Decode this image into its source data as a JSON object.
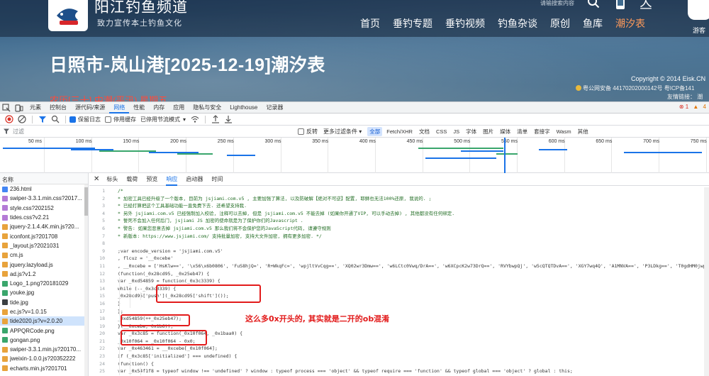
{
  "site": {
    "title": "阳江钓鱼频道",
    "slogan": "致力宣传本土钓鱼文化",
    "search_placeholder": "请输搜索内容",
    "ren_glyph": "亼",
    "guest": "游客",
    "nav": [
      "首页",
      "垂钓专题",
      "垂钓视频",
      "钓鱼杂谈",
      "原创",
      "鱼库",
      "潮汐表"
    ],
    "page_title": "日照市-岚山港[2025-12-19]潮汐表",
    "copyright": "Copyright © 2014 Eisk.CN",
    "icp": "粤公网安备 44170202000142号   粤ICP备141",
    "friend_links": "友情链接：   潮",
    "lunar": "农历[三十] 中潮(平汛) 星期五"
  },
  "devtools": {
    "tabs": [
      "元素",
      "控制台",
      "源代码/来源",
      "网络",
      "性能",
      "内存",
      "应用",
      "隐私与安全",
      "Lighthouse",
      "记录器"
    ],
    "active_tab": "网络",
    "errors": "1",
    "warnings": "4",
    "toolbar": {
      "preserve_log": "保留日志",
      "disable_cache": "停用缓存",
      "throttle": "已停用节流模式"
    },
    "filter": {
      "placeholder": "过滤",
      "invert": "反转",
      "more_filters": "更多过滤条件 ▾",
      "chips": [
        "全部",
        "Fetch/XHR",
        "文档",
        "CSS",
        "JS",
        "字体",
        "图片",
        "媒体",
        "清单",
        "套接字",
        "Wasm",
        "其他"
      ],
      "active_chip": "全部"
    },
    "timeline": {
      "ticks": [
        "50 ms",
        "100 ms",
        "150 ms",
        "200 ms",
        "250 ms",
        "300 ms",
        "350 ms",
        "400 ms",
        "450 ms",
        "500 ms",
        "550 ms",
        "600 ms",
        "650 ms",
        "700 ms",
        "750 ms"
      ]
    },
    "request_list": {
      "header": "名称",
      "items": [
        {
          "name": "236.html",
          "type": "doc"
        },
        {
          "name": "swiper-3.3.1.min.css?2017...",
          "type": "css"
        },
        {
          "name": "style.css?202152",
          "type": "css"
        },
        {
          "name": "tides.css?v2.21",
          "type": "css"
        },
        {
          "name": "jquery-2.1.4.4K.min.js?20...",
          "type": "js"
        },
        {
          "name": "iconfont.js?201708",
          "type": "js"
        },
        {
          "name": "_layout.js?2021031",
          "type": "js"
        },
        {
          "name": "cm.js",
          "type": "js"
        },
        {
          "name": "jquery.lazyload.js",
          "type": "js"
        },
        {
          "name": "ad.js?v1.2",
          "type": "js"
        },
        {
          "name": "Logo_1.png?20181029",
          "type": "img"
        },
        {
          "name": "youke.jpg",
          "type": "img"
        },
        {
          "name": "tide.jpg",
          "type": "dark"
        },
        {
          "name": "ec.js?v=1.0.15",
          "type": "js"
        },
        {
          "name": "tide2020.js?v=2.0.20",
          "type": "js",
          "selected": true
        },
        {
          "name": "APPQRCode.png",
          "type": "img"
        },
        {
          "name": "gongan.png",
          "type": "img"
        },
        {
          "name": "swiper-3.3.1.min.js?20170...",
          "type": "js"
        },
        {
          "name": "jweixin-1.0.0.js?20352222",
          "type": "js"
        },
        {
          "name": "echarts.min.js?201701",
          "type": "js"
        }
      ]
    },
    "detail_tabs": [
      "标头",
      "载荷",
      "预览",
      "响应",
      "启动器",
      "时间"
    ],
    "active_detail_tab": "响应",
    "code_lines": [
      {
        "n": "1",
        "t": "/*",
        "cls": "comment",
        "ind": 0
      },
      {
        "n": "2",
        "t": " * 加密工具已经升级了一个版本, 目前为 jsjiami.com.v5 , 主要加强了算法, 以及防破解【绝对不可逆】配置, 耶稣也无法100%还原, 我说的. ;",
        "cls": "comment",
        "ind": 0
      },
      {
        "n": "3",
        "t": " * 已经打算把这个工具基础功能一直免费下去. 还希望支持我.",
        "cls": "comment",
        "ind": 0
      },
      {
        "n": "4",
        "t": " * 另外 jsjiami.com.v5 已经强制加入校验, 注释可以去掉, 但是 jsjiami.com.v5 不能去掉 (如果你开通了VIP, 可以手动去掉) , 其他都没有任何绑定.",
        "cls": "comment",
        "ind": 0
      },
      {
        "n": "5",
        "t": " * 誓死不会加入任何后门, jsjiami JS 加密的使命就是为了保护你们的Javascript .",
        "cls": "comment",
        "ind": 0
      },
      {
        "n": "6",
        "t": " * 警告: 如果您恶意去掉 jsjiami.com.v5 那么我们将不会保护您的JavaScript代码, 请遵守规则",
        "cls": "comment",
        "ind": 0
      },
      {
        "n": "7",
        "t": " * 新版本: https://www.jsjiami.com/ 支持批量加密, 支持大文件加密, 拥有更多加密. */",
        "cls": "comment",
        "ind": 0
      },
      {
        "n": "8",
        "t": "",
        "cls": "",
        "ind": 0
      },
      {
        "n": "9",
        "t": ";var encode_version = 'jsjiami.com.v5'",
        "cls": "",
        "ind": 0
      },
      {
        "n": "10",
        "t": "  , flcuz = '__0xcebe'",
        "cls": "",
        "ind": 0
      },
      {
        "n": "11",
        "t": "  , __0xcebe = ['HsKlw==', '\\x56\\x6b0806', 'FuS8hjQ=', 'R+WkqFc=', 'wpjltVvCqg==', 'XQ02wr3Dmw==', 'w6LCtc0Vwq/DrA==', 'w6XCpcK2w73DrQ==', 'RVYbwpQj', 'w5cQTQTDvA==', 'XGY7wq4Q', 'A1MNVA==', 'P3LDkg==', 'T0gdHM0jwpfDcw==',",
        "cls": "",
        "ind": 0
      },
      {
        "n": "12",
        "t": "(function(_0x28cd95, _0x25eb47) {",
        "cls": "",
        "ind": 0
      },
      {
        "n": "13",
        "t": "    var _0xd54859 = function(_0x3c3339) {",
        "cls": "",
        "ind": 1
      },
      {
        "n": "14",
        "t": "        while (--_0x3c3339) {",
        "cls": "",
        "ind": 2
      },
      {
        "n": "15",
        "t": "            _0x28cd95['push'](_0x28cd95['shift']());",
        "cls": "",
        "ind": 3
      },
      {
        "n": "16",
        "t": "        }",
        "cls": "",
        "ind": 2
      },
      {
        "n": "17",
        "t": "    };",
        "cls": "",
        "ind": 1
      },
      {
        "n": "18",
        "t": "    _0xd54859(++_0x25eb47);",
        "cls": "",
        "ind": 1
      },
      {
        "n": "19",
        "t": "}(__0xcebe, 0x1b6));",
        "cls": "",
        "ind": 0
      },
      {
        "n": "20",
        "t": "var _0x3c85 = function(_0x10f064, _0x1baa0) {",
        "cls": "",
        "ind": 0
      },
      {
        "n": "21",
        "t": "    _0x10f064 = _0x10f064 - 0x0;",
        "cls": "",
        "ind": 1
      },
      {
        "n": "22",
        "t": "    var _0x463461 = __0xcebe[_0x10f064];",
        "cls": "",
        "ind": 1
      },
      {
        "n": "23",
        "t": "    if (_0x3c85['initialized'] === undefined) {",
        "cls": "",
        "ind": 1
      },
      {
        "n": "24",
        "t": "        (function() {",
        "cls": "",
        "ind": 2
      },
      {
        "n": "25",
        "t": "            var _0x54f1f8 = typeof window !== 'undefined' ? window : typeof process === 'object' && typeof require === 'function' && typeof global === 'object' ? global : this;",
        "cls": "",
        "ind": 3
      }
    ],
    "annotation": "这么多0x开头的, 其实就是二开的ob混淆"
  }
}
